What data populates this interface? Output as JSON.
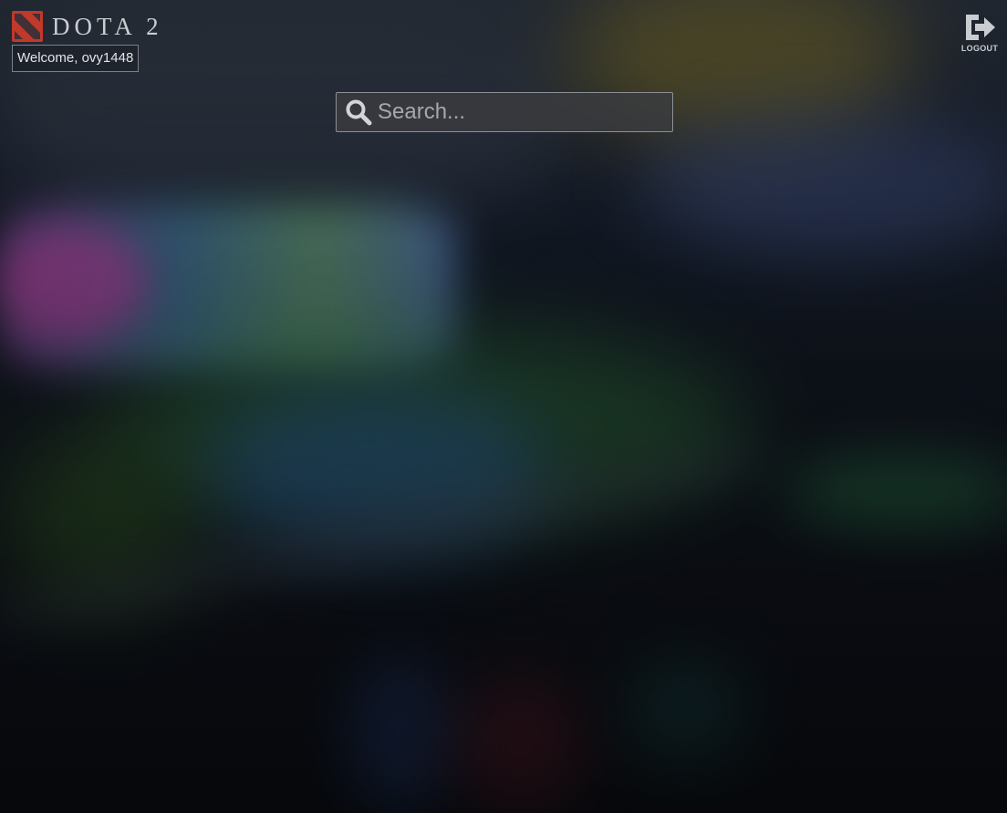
{
  "header": {
    "brand": "DOTA 2",
    "welcome_text": "Welcome, ovy1448",
    "logout_label": "LOGOUT"
  },
  "search": {
    "placeholder": "Search...",
    "value": ""
  },
  "icons": {
    "logo": "dota2-logo-icon",
    "logout": "logout-icon",
    "search": "search-icon"
  },
  "colors": {
    "brand_red": "#c0392b",
    "text_light": "#c9ccd1",
    "search_bg": "#3a3c40",
    "search_border": "#8c9096"
  }
}
